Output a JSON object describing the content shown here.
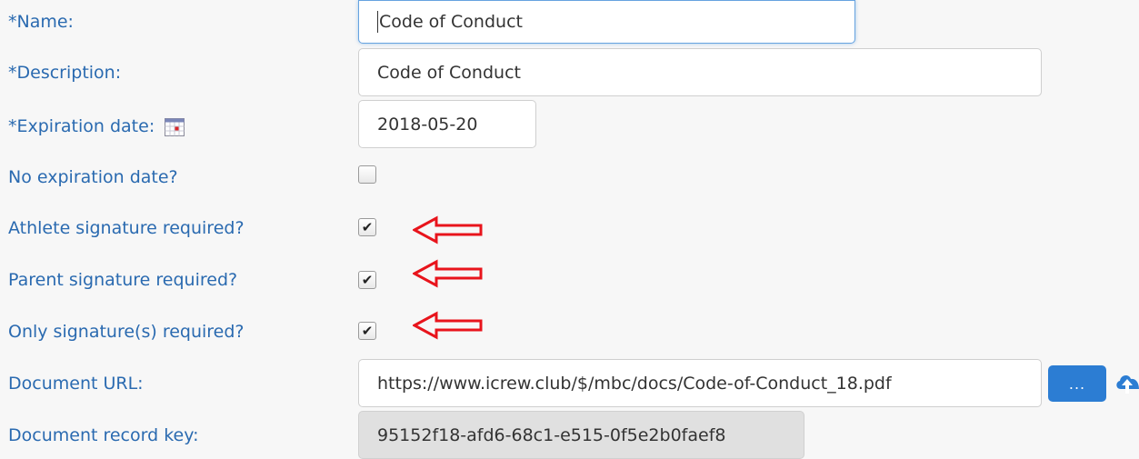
{
  "form": {
    "name": {
      "label": "*Name:",
      "value": "Code of Conduct"
    },
    "description": {
      "label": "*Description:",
      "value": "Code of Conduct"
    },
    "expiration": {
      "label": "*Expiration date:",
      "value": "2018-05-20"
    },
    "no_expiration": {
      "label": "No expiration date?",
      "checked": false
    },
    "athlete_signature": {
      "label": "Athlete signature required?",
      "checked": true
    },
    "parent_signature": {
      "label": "Parent signature required?",
      "checked": true
    },
    "only_signature": {
      "label": "Only signature(s) required?",
      "checked": true
    },
    "document_url": {
      "label": "Document URL:",
      "value": "https://www.icrew.club/$/mbc/docs/Code-of-Conduct_18.pdf",
      "browse_label": "..."
    },
    "document_key": {
      "label": "Document record key:",
      "value": "95152f18-afd6-68c1-e515-0f5e2b0faef8"
    }
  },
  "icons": {
    "calendar": "calendar-icon",
    "upload": "cloud-upload-icon",
    "annotation": "red-arrow-icon"
  },
  "colors": {
    "label": "#2a6ab0",
    "button": "#2c7dd3",
    "annotation": "#e8141c"
  }
}
